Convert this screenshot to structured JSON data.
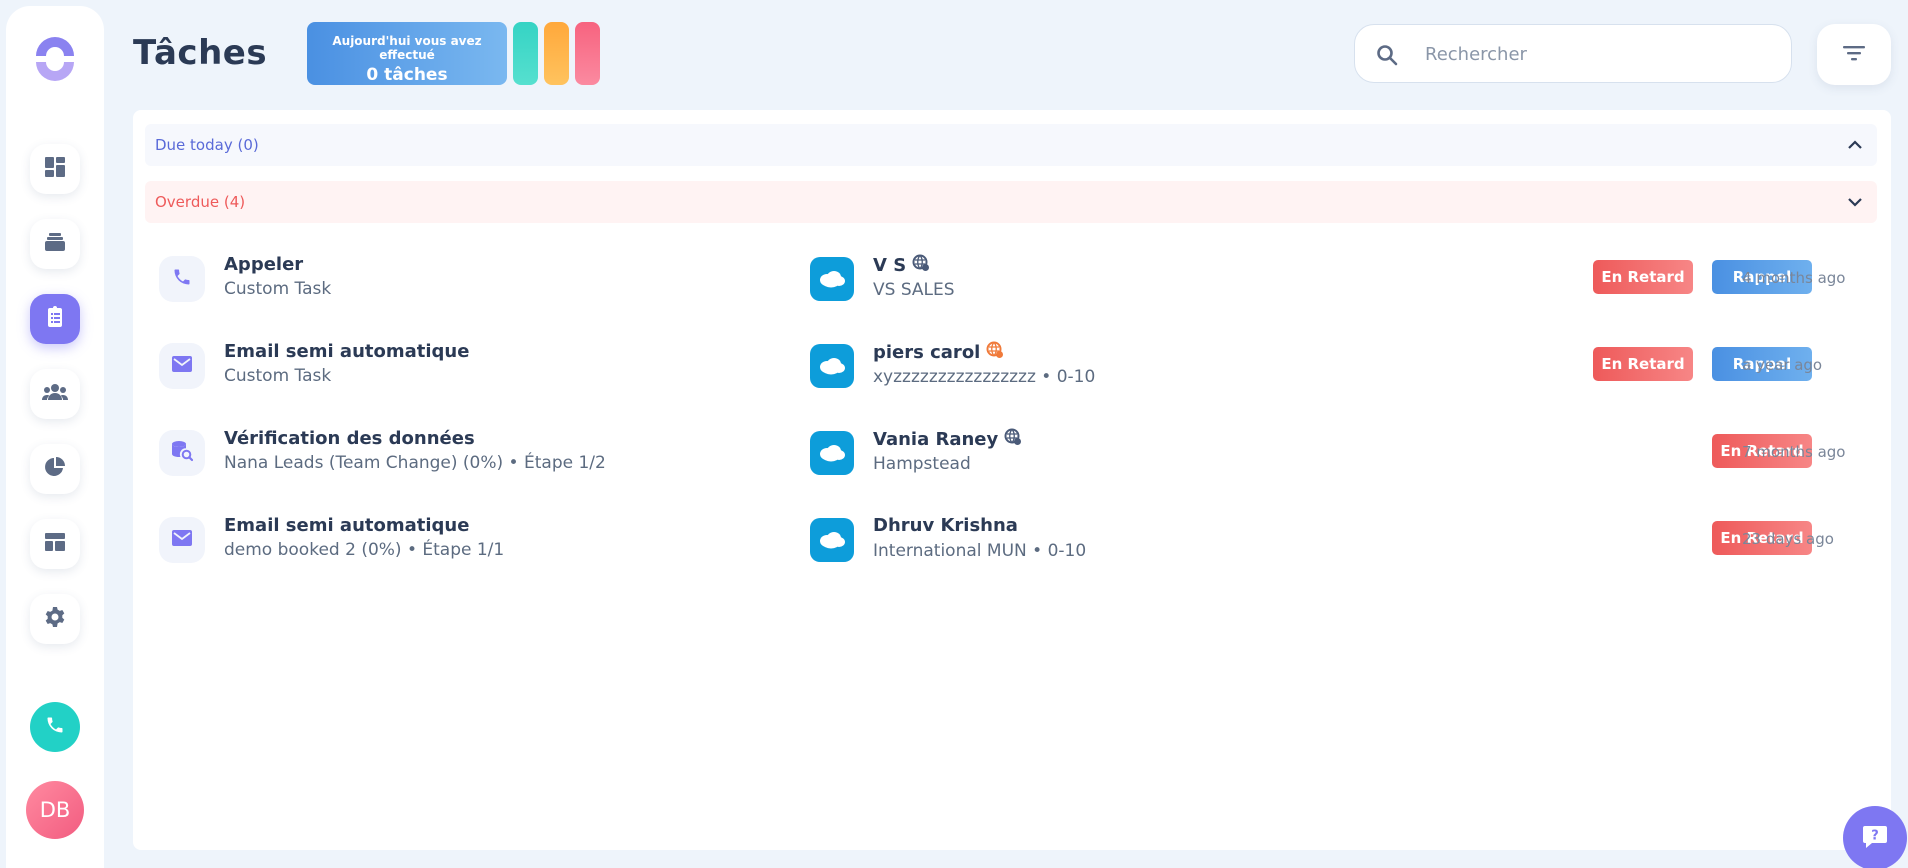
{
  "sidebar": {
    "logo_icon": "ring-logo-icon",
    "items": [
      {
        "name": "dashboard",
        "icon": "dashboard-icon",
        "active": false
      },
      {
        "name": "inbox",
        "icon": "stack-icon",
        "active": false
      },
      {
        "name": "tasks",
        "icon": "clipboard-list-icon",
        "active": true
      },
      {
        "name": "contacts",
        "icon": "group-icon",
        "active": false
      },
      {
        "name": "reports",
        "icon": "pie-chart-icon",
        "active": false
      },
      {
        "name": "templates",
        "icon": "layout-icon",
        "active": false
      },
      {
        "name": "settings",
        "icon": "gear-icon",
        "active": false
      }
    ],
    "phone_icon": "phone-icon",
    "avatar_initials": "DB"
  },
  "header": {
    "title": "Tâches",
    "today_card": {
      "line1": "Aujourd'hui vous avez effectué",
      "line2": "0 tâches"
    },
    "pill_colors": [
      "#3fd6c8",
      "#ffb347",
      "#f86f8f"
    ],
    "search_placeholder": "Rechercher",
    "search_value": ""
  },
  "sections": {
    "due_today": "Due today (0)",
    "overdue": "Overdue (4)"
  },
  "tasks": [
    {
      "icon": "phone-icon",
      "title": "Appeler",
      "subtitle": "Custom Task",
      "contact_name": "V S",
      "contact_status_color": "#4a5a78",
      "contact_sub": "VS SALES",
      "badge_late": "En Retard",
      "badge_reminder": "Rappel",
      "time": "4 months ago"
    },
    {
      "icon": "mail-icon",
      "title": "Email semi automatique",
      "subtitle": "Custom Task",
      "contact_name": "piers carol",
      "contact_status_color": "#f07a3a",
      "contact_sub": "xyzzzzzzzzzzzzzzzz • 0-10",
      "badge_late": "En Retard",
      "badge_reminder": "Rappel",
      "time": "a year ago"
    },
    {
      "icon": "database-search-icon",
      "title": "Vérification des données",
      "subtitle": "Nana Leads (Team Change) (0%) • Étape 1/2",
      "contact_name": "Vania Raney",
      "contact_status_color": "#4a5a78",
      "contact_sub": "Hampstead",
      "badge_late": "En Retard",
      "time": "7 months ago"
    },
    {
      "icon": "mail-icon",
      "title": "Email semi automatique",
      "subtitle": "demo booked 2 (0%) • Étape 1/1",
      "contact_name": "Dhruv Krishna",
      "contact_status_color": "",
      "contact_sub": "International MUN • 0-10",
      "badge_late": "En Retard",
      "time": "23 days ago"
    }
  ],
  "colors": {
    "accent": "#7e77f2",
    "late": "#ee5a5a",
    "reminder": "#4a90e2",
    "salesforce": "#0d9dda"
  }
}
